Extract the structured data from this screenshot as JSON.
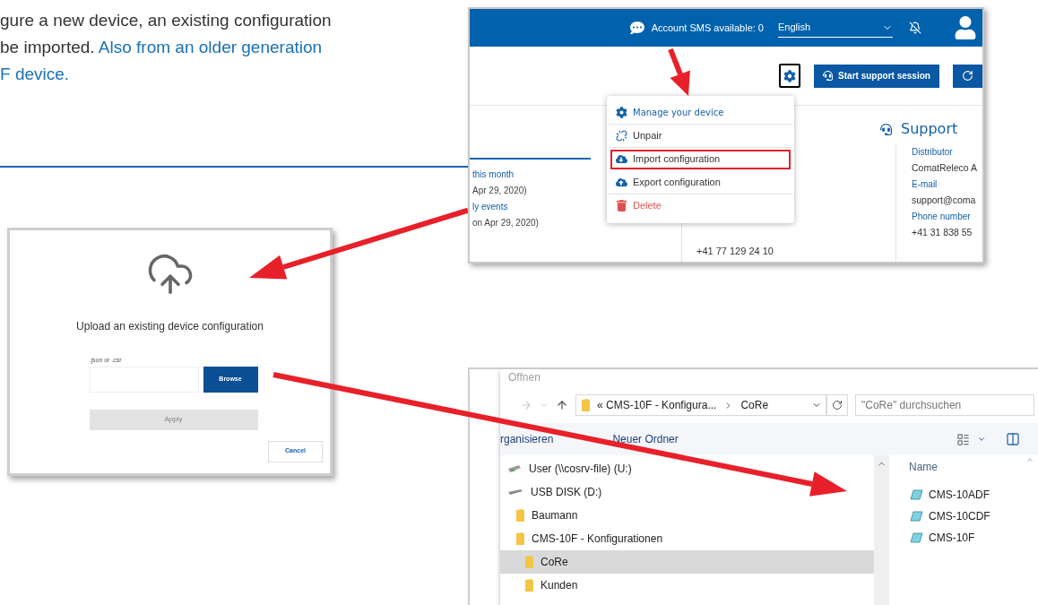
{
  "intro": {
    "lines": [
      [
        {
          "text": "gure a new device, an existing configuration",
          "highlight": false
        }
      ],
      [
        {
          "text": "be imported. ",
          "highlight": false
        },
        {
          "text": "Also from an older generation",
          "highlight": true
        }
      ],
      [
        {
          "text": "F device.",
          "highlight": true
        }
      ]
    ]
  },
  "portal": {
    "sms": "Account SMS available: 0",
    "language": "English",
    "support_button": "Start support session",
    "events": [
      {
        "text": "this month",
        "kind": "link"
      },
      {
        "text": "Apr 29, 2020)",
        "kind": "text"
      },
      {
        "text": "ly events",
        "kind": "link"
      },
      {
        "text": "on Apr 29, 2020)",
        "kind": "text"
      }
    ],
    "phone": "+41 77 129 24 10",
    "support": {
      "title": "Support",
      "fields": [
        {
          "label": "Distributor",
          "value": "ComatReleco A"
        },
        {
          "label": "E-mail",
          "value": "support@coma"
        },
        {
          "label": "Phone number",
          "value": "+41 31 838 55"
        }
      ]
    },
    "menu": [
      {
        "kind": "manage",
        "label": "Manage your device",
        "highlighted": false,
        "divider_after": true
      },
      {
        "kind": "unpair",
        "label": "Unpair",
        "highlighted": false,
        "divider_after": true
      },
      {
        "kind": "import",
        "label": "Import configuration",
        "highlighted": true,
        "divider_after": false
      },
      {
        "kind": "export",
        "label": "Export configuration",
        "highlighted": false,
        "divider_after": true
      },
      {
        "kind": "delete",
        "label": "Delete",
        "highlighted": false,
        "divider_after": false
      }
    ]
  },
  "dialog": {
    "title": "Upload an existing device configuration",
    "field_label": ".json or .csr",
    "browse": "Browse",
    "apply": {
      "label": "Apply",
      "disabled": true
    },
    "cancel": "Cancel"
  },
  "explorer": {
    "title": "Offnen",
    "path": [
      "« CMS-10F - Konfigura...",
      "CoRe"
    ],
    "search_placeholder": "\"CoRe\" durchsuchen",
    "toolbar": [
      "rganisieren",
      "Neuer Ordner"
    ],
    "tree": [
      {
        "label": "User (\\\\cosrv-file) (U:)",
        "kind": "network",
        "selected": false
      },
      {
        "label": "USB DISK (D:)",
        "kind": "drive",
        "selected": false,
        "children": [
          {
            "label": "Baumann",
            "kind": "folder",
            "selected": false
          },
          {
            "label": "CMS-10F - Konfigurationen",
            "kind": "folder",
            "selected": false,
            "children": [
              {
                "label": "CoRe",
                "kind": "folder",
                "selected": true
              },
              {
                "label": "Kunden",
                "kind": "folder",
                "selected": false
              }
            ]
          }
        ]
      }
    ],
    "column": "Name",
    "files": [
      "CMS-10ADF",
      "CMS-10CDF",
      "CMS-10F"
    ]
  }
}
